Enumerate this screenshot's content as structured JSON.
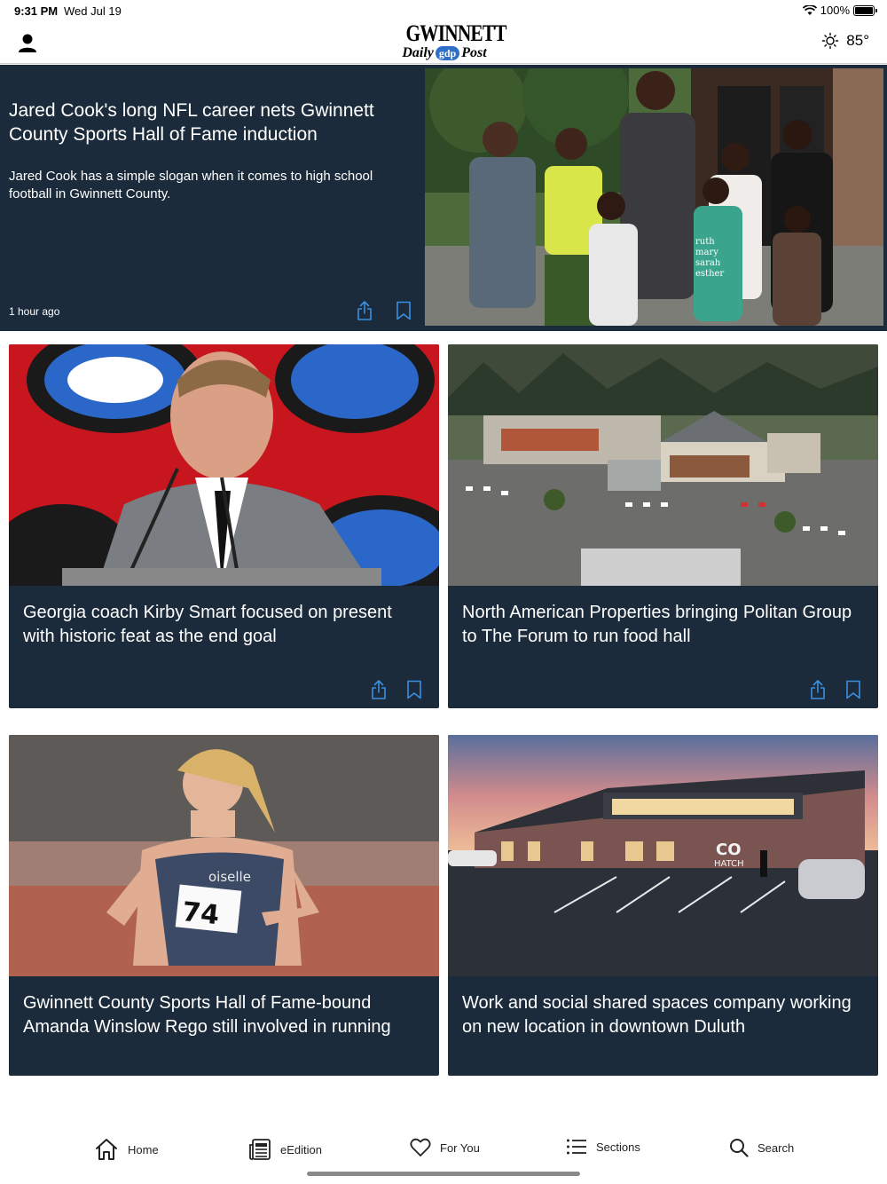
{
  "status_bar": {
    "time": "9:31 PM",
    "date": "Wed Jul 19",
    "battery": "100%"
  },
  "header": {
    "logo_top": "GWINNETT",
    "logo_daily": "Daily",
    "logo_badge": "gdp",
    "logo_post": "Post",
    "temperature": "85°"
  },
  "hero": {
    "title": "Jared Cook's long NFL career nets Gwinnett County Sports Hall of Fame induction",
    "summary": "Jared Cook has a simple slogan when it comes to high school football in Gwinnett County.",
    "time_ago": "1 hour ago"
  },
  "cards": [
    {
      "title": "Georgia coach Kirby Smart focused on present with historic feat as the end goal"
    },
    {
      "title": "North American Properties bringing Politan Group to The Forum to run food hall"
    },
    {
      "title": "Gwinnett County Sports Hall of Fame-bound Amanda Winslow Rego still involved in running"
    },
    {
      "title": "Work and social shared spaces company working on new location in downtown Duluth"
    }
  ],
  "photo_text": {
    "shirt": [
      "ruth",
      "mary",
      "sarah",
      "esther"
    ],
    "bib_number": "74",
    "jersey_brand": "oiselle",
    "building_sign_top": "CO",
    "building_sign_bottom": "HATCH"
  },
  "tab_bar": {
    "tabs": [
      {
        "label": "Home",
        "icon": "house-icon"
      },
      {
        "label": "eEdition",
        "icon": "newspaper-icon"
      },
      {
        "label": "For You",
        "icon": "heart-icon"
      },
      {
        "label": "Sections",
        "icon": "list-icon"
      },
      {
        "label": "Search",
        "icon": "magnifier-icon"
      }
    ]
  },
  "colors": {
    "card_bg": "#1b2b3b",
    "action_icon": "#3a8fe0",
    "text_on_card": "#ffffff"
  }
}
